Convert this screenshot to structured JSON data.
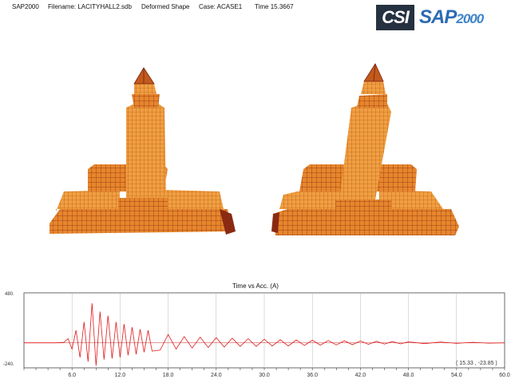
{
  "header": {
    "app_name": "SAP2000",
    "filename": "Filename:  LACITYHALL2.sdb",
    "view_mode": "Deformed Shape",
    "case": "Case:  ACASE1",
    "time": "Time 15.3667"
  },
  "logo": {
    "left": "CSI",
    "right_main": "SAP",
    "right_number": "2000"
  },
  "colors": {
    "structure": "#e0781c",
    "structure_edge": "#8a2a12",
    "trace": "#e01818",
    "grid": "#b8b8b8"
  },
  "chart_data": {
    "type": "line",
    "title": "Time vs Acc. (A)",
    "xlabel": "",
    "ylabel": "",
    "xlim": [
      0,
      60
    ],
    "ylim": [
      -240,
      480
    ],
    "x_ticks": [
      "6.0",
      "12.0",
      "18.0",
      "24.0",
      "30.0",
      "36.0",
      "42.0",
      "48.0",
      "54.0",
      "60.0"
    ],
    "y_ticks": [
      "480.",
      "-240."
    ],
    "readout": "( 15.33 , -23.85 )",
    "grid": true,
    "series": [
      {
        "x": [
          0,
          4,
          5,
          5.5,
          6,
          6.5,
          7,
          7.5,
          8,
          8.5,
          9,
          9.5,
          10,
          10.5,
          11,
          11.5,
          12,
          12.5,
          13,
          13.5,
          14,
          14.5,
          15,
          15.5,
          16,
          17,
          18,
          19,
          20,
          21,
          22,
          23,
          24,
          25,
          26,
          27,
          28,
          29,
          30,
          31,
          32,
          33,
          34,
          35,
          36,
          37,
          38,
          39,
          40,
          41,
          42,
          43,
          44,
          45,
          46,
          47,
          48,
          50,
          52,
          54,
          56,
          58,
          60
        ],
        "y": [
          0,
          0,
          5,
          40,
          -60,
          120,
          -140,
          200,
          -180,
          380,
          -220,
          300,
          -160,
          260,
          -150,
          200,
          -140,
          180,
          -120,
          150,
          -110,
          130,
          -90,
          120,
          -80,
          -70,
          80,
          -60,
          60,
          -50,
          55,
          -45,
          50,
          -40,
          45,
          -35,
          40,
          -35,
          35,
          -30,
          30,
          -30,
          28,
          -25,
          25,
          -22,
          22,
          -20,
          20,
          -18,
          18,
          -15,
          15,
          -12,
          12,
          -10,
          10,
          -8,
          8,
          -6,
          5,
          -3,
          0
        ]
      }
    ]
  }
}
